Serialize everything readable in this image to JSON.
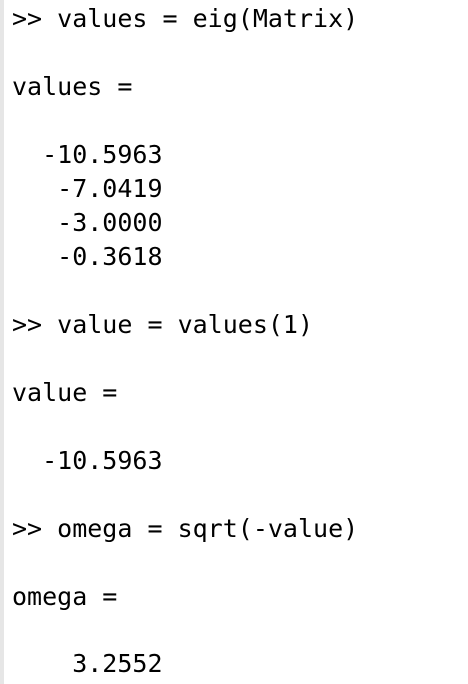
{
  "console": {
    "block1": {
      "command": ">> values = eig(Matrix)",
      "var_header": "values =",
      "values": [
        "  -10.5963",
        "   -7.0419",
        "   -3.0000",
        "   -0.3618"
      ]
    },
    "block2": {
      "command": ">> value = values(1)",
      "var_header": "value =",
      "value": "  -10.5963"
    },
    "block3": {
      "command": ">> omega = sqrt(-value)",
      "var_header": "omega =",
      "value": "    3.2552"
    }
  }
}
